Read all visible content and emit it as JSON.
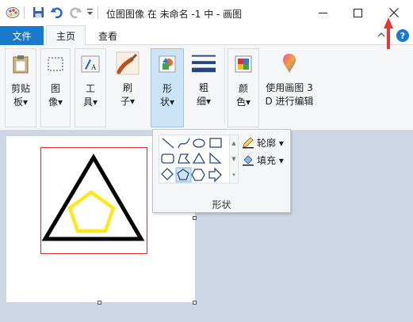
{
  "window": {
    "title": "位图图像 在 未命名 -1 中 - 画图"
  },
  "quick_access": {
    "icons": [
      "paint-app-icon",
      "save-icon",
      "undo-icon",
      "redo-icon",
      "customize-dropdown-icon"
    ]
  },
  "tabs": {
    "file": "文件",
    "home": "主页",
    "view": "查看"
  },
  "ribbon": {
    "clipboard": {
      "line1": "剪贴",
      "line2": "板▾"
    },
    "image": {
      "line1": "图",
      "line2": "像▾"
    },
    "tools": {
      "line1": "工",
      "line2": "具▾"
    },
    "brushes": {
      "line1": "刷",
      "line2": "子▾"
    },
    "shapes": {
      "line1": "形",
      "line2": "状▾"
    },
    "size": {
      "line1": "粗",
      "line2": "细▾"
    },
    "colors": {
      "line1": "颜",
      "line2": "色▾"
    },
    "paint3d": {
      "line1": "使用画图 3",
      "line2": "D 进行编辑"
    }
  },
  "shapes_panel": {
    "outline": "轮廓 ▾",
    "fill": "填充 ▾",
    "label": "形状"
  },
  "colors": {
    "accent": "#1979ca",
    "triangle": "#000000",
    "pentagon": "#ffe81a",
    "selection": "#d83030"
  }
}
